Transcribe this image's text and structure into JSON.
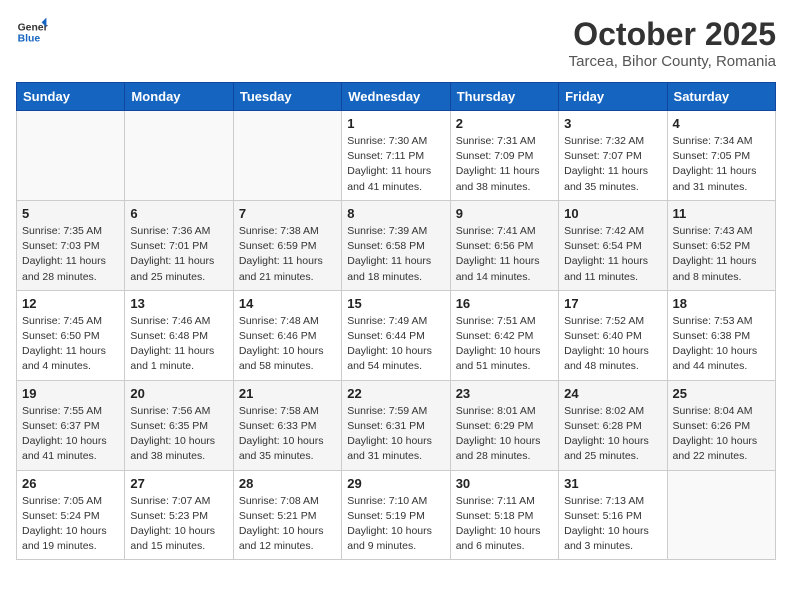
{
  "header": {
    "logo_general": "General",
    "logo_blue": "Blue",
    "month": "October 2025",
    "location": "Tarcea, Bihor County, Romania"
  },
  "weekdays": [
    "Sunday",
    "Monday",
    "Tuesday",
    "Wednesday",
    "Thursday",
    "Friday",
    "Saturday"
  ],
  "weeks": [
    [
      {
        "day": "",
        "sunrise": "",
        "sunset": "",
        "daylight": ""
      },
      {
        "day": "",
        "sunrise": "",
        "sunset": "",
        "daylight": ""
      },
      {
        "day": "",
        "sunrise": "",
        "sunset": "",
        "daylight": ""
      },
      {
        "day": "1",
        "sunrise": "Sunrise: 7:30 AM",
        "sunset": "Sunset: 7:11 PM",
        "daylight": "Daylight: 11 hours and 41 minutes."
      },
      {
        "day": "2",
        "sunrise": "Sunrise: 7:31 AM",
        "sunset": "Sunset: 7:09 PM",
        "daylight": "Daylight: 11 hours and 38 minutes."
      },
      {
        "day": "3",
        "sunrise": "Sunrise: 7:32 AM",
        "sunset": "Sunset: 7:07 PM",
        "daylight": "Daylight: 11 hours and 35 minutes."
      },
      {
        "day": "4",
        "sunrise": "Sunrise: 7:34 AM",
        "sunset": "Sunset: 7:05 PM",
        "daylight": "Daylight: 11 hours and 31 minutes."
      }
    ],
    [
      {
        "day": "5",
        "sunrise": "Sunrise: 7:35 AM",
        "sunset": "Sunset: 7:03 PM",
        "daylight": "Daylight: 11 hours and 28 minutes."
      },
      {
        "day": "6",
        "sunrise": "Sunrise: 7:36 AM",
        "sunset": "Sunset: 7:01 PM",
        "daylight": "Daylight: 11 hours and 25 minutes."
      },
      {
        "day": "7",
        "sunrise": "Sunrise: 7:38 AM",
        "sunset": "Sunset: 6:59 PM",
        "daylight": "Daylight: 11 hours and 21 minutes."
      },
      {
        "day": "8",
        "sunrise": "Sunrise: 7:39 AM",
        "sunset": "Sunset: 6:58 PM",
        "daylight": "Daylight: 11 hours and 18 minutes."
      },
      {
        "day": "9",
        "sunrise": "Sunrise: 7:41 AM",
        "sunset": "Sunset: 6:56 PM",
        "daylight": "Daylight: 11 hours and 14 minutes."
      },
      {
        "day": "10",
        "sunrise": "Sunrise: 7:42 AM",
        "sunset": "Sunset: 6:54 PM",
        "daylight": "Daylight: 11 hours and 11 minutes."
      },
      {
        "day": "11",
        "sunrise": "Sunrise: 7:43 AM",
        "sunset": "Sunset: 6:52 PM",
        "daylight": "Daylight: 11 hours and 8 minutes."
      }
    ],
    [
      {
        "day": "12",
        "sunrise": "Sunrise: 7:45 AM",
        "sunset": "Sunset: 6:50 PM",
        "daylight": "Daylight: 11 hours and 4 minutes."
      },
      {
        "day": "13",
        "sunrise": "Sunrise: 7:46 AM",
        "sunset": "Sunset: 6:48 PM",
        "daylight": "Daylight: 11 hours and 1 minute."
      },
      {
        "day": "14",
        "sunrise": "Sunrise: 7:48 AM",
        "sunset": "Sunset: 6:46 PM",
        "daylight": "Daylight: 10 hours and 58 minutes."
      },
      {
        "day": "15",
        "sunrise": "Sunrise: 7:49 AM",
        "sunset": "Sunset: 6:44 PM",
        "daylight": "Daylight: 10 hours and 54 minutes."
      },
      {
        "day": "16",
        "sunrise": "Sunrise: 7:51 AM",
        "sunset": "Sunset: 6:42 PM",
        "daylight": "Daylight: 10 hours and 51 minutes."
      },
      {
        "day": "17",
        "sunrise": "Sunrise: 7:52 AM",
        "sunset": "Sunset: 6:40 PM",
        "daylight": "Daylight: 10 hours and 48 minutes."
      },
      {
        "day": "18",
        "sunrise": "Sunrise: 7:53 AM",
        "sunset": "Sunset: 6:38 PM",
        "daylight": "Daylight: 10 hours and 44 minutes."
      }
    ],
    [
      {
        "day": "19",
        "sunrise": "Sunrise: 7:55 AM",
        "sunset": "Sunset: 6:37 PM",
        "daylight": "Daylight: 10 hours and 41 minutes."
      },
      {
        "day": "20",
        "sunrise": "Sunrise: 7:56 AM",
        "sunset": "Sunset: 6:35 PM",
        "daylight": "Daylight: 10 hours and 38 minutes."
      },
      {
        "day": "21",
        "sunrise": "Sunrise: 7:58 AM",
        "sunset": "Sunset: 6:33 PM",
        "daylight": "Daylight: 10 hours and 35 minutes."
      },
      {
        "day": "22",
        "sunrise": "Sunrise: 7:59 AM",
        "sunset": "Sunset: 6:31 PM",
        "daylight": "Daylight: 10 hours and 31 minutes."
      },
      {
        "day": "23",
        "sunrise": "Sunrise: 8:01 AM",
        "sunset": "Sunset: 6:29 PM",
        "daylight": "Daylight: 10 hours and 28 minutes."
      },
      {
        "day": "24",
        "sunrise": "Sunrise: 8:02 AM",
        "sunset": "Sunset: 6:28 PM",
        "daylight": "Daylight: 10 hours and 25 minutes."
      },
      {
        "day": "25",
        "sunrise": "Sunrise: 8:04 AM",
        "sunset": "Sunset: 6:26 PM",
        "daylight": "Daylight: 10 hours and 22 minutes."
      }
    ],
    [
      {
        "day": "26",
        "sunrise": "Sunrise: 7:05 AM",
        "sunset": "Sunset: 5:24 PM",
        "daylight": "Daylight: 10 hours and 19 minutes."
      },
      {
        "day": "27",
        "sunrise": "Sunrise: 7:07 AM",
        "sunset": "Sunset: 5:23 PM",
        "daylight": "Daylight: 10 hours and 15 minutes."
      },
      {
        "day": "28",
        "sunrise": "Sunrise: 7:08 AM",
        "sunset": "Sunset: 5:21 PM",
        "daylight": "Daylight: 10 hours and 12 minutes."
      },
      {
        "day": "29",
        "sunrise": "Sunrise: 7:10 AM",
        "sunset": "Sunset: 5:19 PM",
        "daylight": "Daylight: 10 hours and 9 minutes."
      },
      {
        "day": "30",
        "sunrise": "Sunrise: 7:11 AM",
        "sunset": "Sunset: 5:18 PM",
        "daylight": "Daylight: 10 hours and 6 minutes."
      },
      {
        "day": "31",
        "sunrise": "Sunrise: 7:13 AM",
        "sunset": "Sunset: 5:16 PM",
        "daylight": "Daylight: 10 hours and 3 minutes."
      },
      {
        "day": "",
        "sunrise": "",
        "sunset": "",
        "daylight": ""
      }
    ]
  ]
}
